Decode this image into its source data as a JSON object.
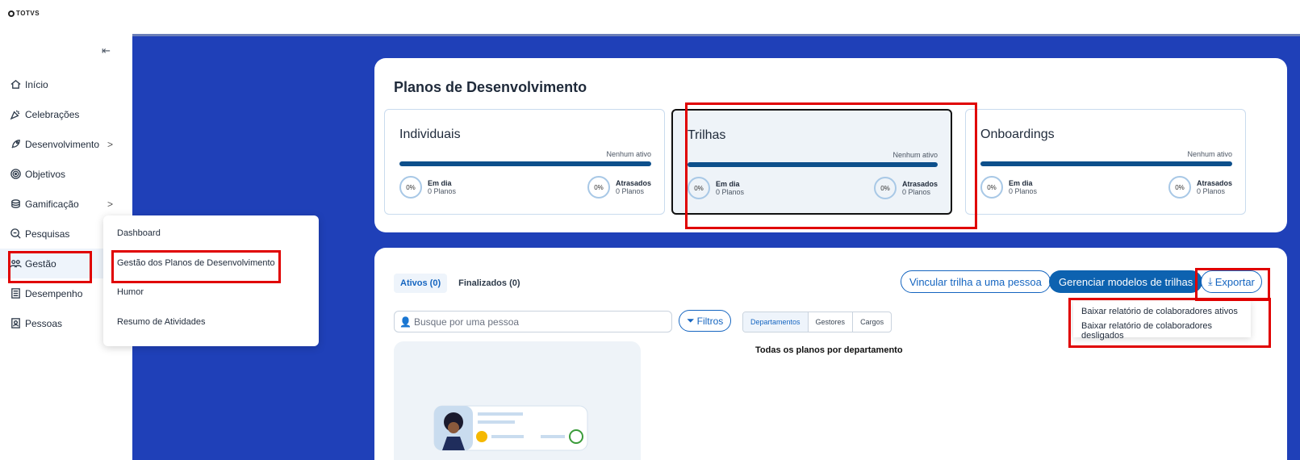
{
  "brand": {
    "name": "TOTVS"
  },
  "sidebar": {
    "collapse_symbol": "⇤",
    "items": [
      {
        "label": "Início",
        "icon": "home-icon"
      },
      {
        "label": "Celebrações",
        "icon": "party-icon"
      },
      {
        "label": "Desenvolvimento",
        "icon": "rocket-icon",
        "chevron": ">"
      },
      {
        "label": "Objetivos",
        "icon": "target-icon"
      },
      {
        "label": "Gamificação",
        "icon": "coins-icon",
        "chevron": ">"
      },
      {
        "label": "Pesquisas",
        "icon": "search-doc-icon"
      },
      {
        "label": "Gestão",
        "icon": "users-icon"
      },
      {
        "label": "Desempenho",
        "icon": "list-icon"
      },
      {
        "label": "Pessoas",
        "icon": "person-badge-icon"
      }
    ]
  },
  "submenu": {
    "items": [
      "Dashboard",
      "Gestão dos Planos de Desenvolvimento",
      "Humor",
      "Resumo de Atividades"
    ]
  },
  "summary": {
    "title": "Planos de Desenvolvimento",
    "cards": [
      {
        "title": "Individuais",
        "status": "Nenhum ativo",
        "left_pct": "0%",
        "left_label": "Em dia",
        "left_count": "0 Planos",
        "right_pct": "0%",
        "right_label": "Atrasados",
        "right_count": "0 Planos"
      },
      {
        "title": "Trilhas",
        "status": "Nenhum ativo",
        "left_pct": "0%",
        "left_label": "Em dia",
        "left_count": "0 Planos",
        "right_pct": "0%",
        "right_label": "Atrasados",
        "right_count": "0 Planos"
      },
      {
        "title": "Onboardings",
        "status": "Nenhum ativo",
        "left_pct": "0%",
        "left_label": "Em dia",
        "left_count": "0 Planos",
        "right_pct": "0%",
        "right_label": "Atrasados",
        "right_count": "0 Planos"
      }
    ]
  },
  "main": {
    "tabs": [
      {
        "label": "Ativos (0)"
      },
      {
        "label": "Finalizados (0)"
      }
    ],
    "link_button": "Vincular trilha a uma pessoa",
    "manage_button": "Gerenciar modelos de trilhas",
    "export_button": "Exportar",
    "search_placeholder": "Busque por uma pessoa",
    "filter_button": "Filtros",
    "segments": [
      "Departamentos",
      "Gestores",
      "Cargos"
    ],
    "dept_title": "Todas os planos por departamento"
  },
  "export_menu": {
    "items": [
      "Baixar relatório de colaboradores ativos",
      "Baixar relatório de colaboradores desligados"
    ]
  },
  "colors": {
    "banner": "#1f40b8",
    "accent": "#1565c0",
    "highlight": "#e00000"
  }
}
